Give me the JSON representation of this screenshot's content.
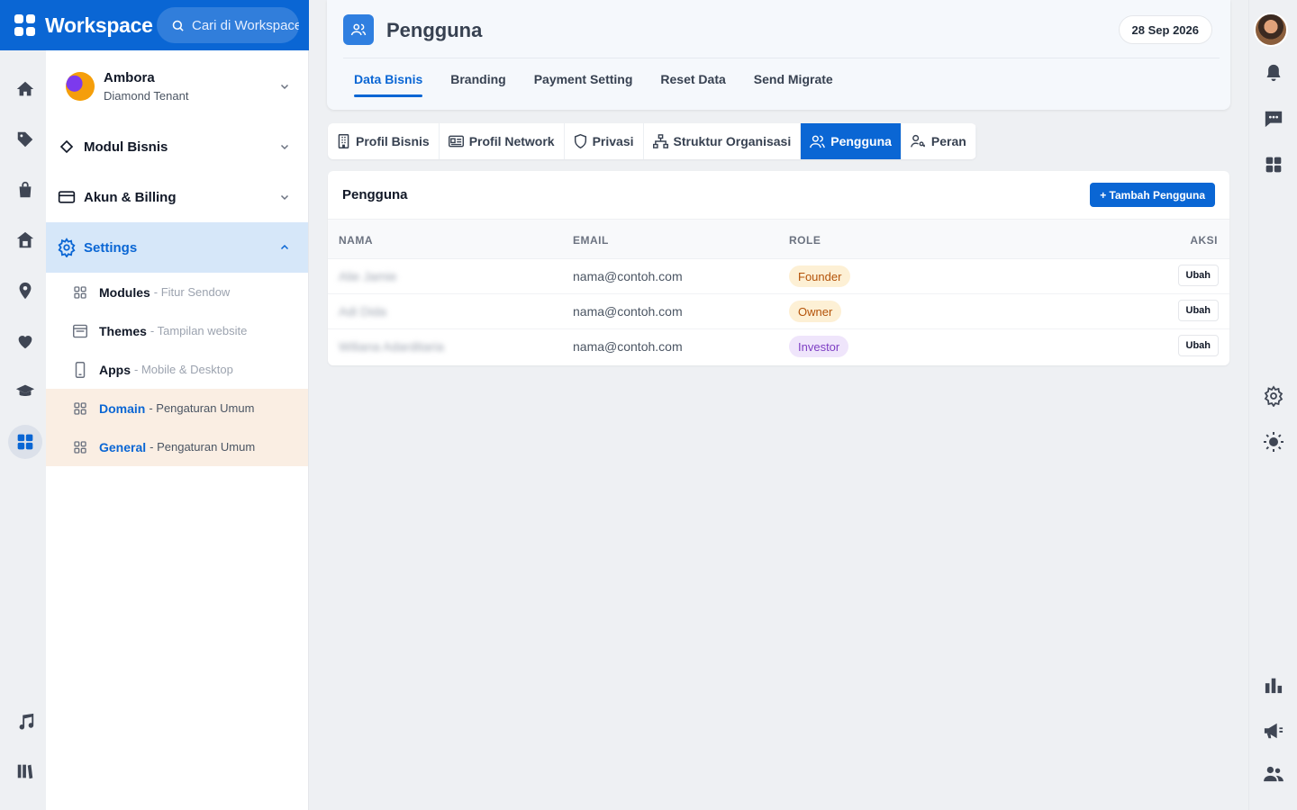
{
  "brand": {
    "title": "Workspace",
    "search_placeholder": "Cari di Workspace"
  },
  "tenant": {
    "name": "Ambora",
    "plan": "Diamond Tenant"
  },
  "sidebar": {
    "menus": [
      {
        "label": "Modul Bisnis"
      },
      {
        "label": "Akun & Billing"
      },
      {
        "label": "Settings"
      }
    ],
    "settings_items": [
      {
        "label": "Modules",
        "desc": "- Fitur Sendow"
      },
      {
        "label": "Themes",
        "desc": "- Tampilan website"
      },
      {
        "label": "Apps",
        "desc": "- Mobile & Desktop"
      },
      {
        "label": "Domain",
        "desc": "- Pengaturan Umum"
      },
      {
        "label": "General",
        "desc": "- Pengaturan Umum"
      }
    ]
  },
  "header": {
    "title": "Pengguna",
    "date": "28 Sep 2026",
    "tabs": [
      {
        "label": "Data Bisnis"
      },
      {
        "label": "Branding"
      },
      {
        "label": "Payment Setting"
      },
      {
        "label": "Reset Data"
      },
      {
        "label": "Send Migrate"
      }
    ]
  },
  "sub_tabs": [
    {
      "label": "Profil Bisnis",
      "icon": "building-icon"
    },
    {
      "label": "Profil Network",
      "icon": "id-card-icon"
    },
    {
      "label": "Privasi",
      "icon": "shield-icon"
    },
    {
      "label": "Struktur Organisasi",
      "icon": "org-chart-icon"
    },
    {
      "label": "Pengguna",
      "icon": "users-icon"
    },
    {
      "label": "Peran",
      "icon": "user-key-icon"
    }
  ],
  "users_card": {
    "title": "Pengguna",
    "add_button": "+ Tambah Pengguna",
    "columns": {
      "name": "NAMA",
      "email": "EMAIL",
      "role": "ROLE",
      "action": "AKSI"
    },
    "rows": [
      {
        "name": "Alie Jamie",
        "email": "nama@contoh.com",
        "role": "Founder",
        "action": "Ubah"
      },
      {
        "name": "Adi Dida",
        "email": "nama@contoh.com",
        "role": "Owner",
        "action": "Ubah"
      },
      {
        "name": "Wiliana Adarditaria",
        "email": "nama@contoh.com",
        "role": "Investor",
        "action": "Ubah"
      }
    ]
  },
  "colors": {
    "primary": "#0a66d4",
    "founder_bg": "#fdf0d5",
    "founder_fg": "#b45309",
    "owner_bg": "#fdf0d5",
    "owner_fg": "#b45309",
    "investor_bg": "#efe5fb",
    "investor_fg": "#7e3fc4"
  }
}
